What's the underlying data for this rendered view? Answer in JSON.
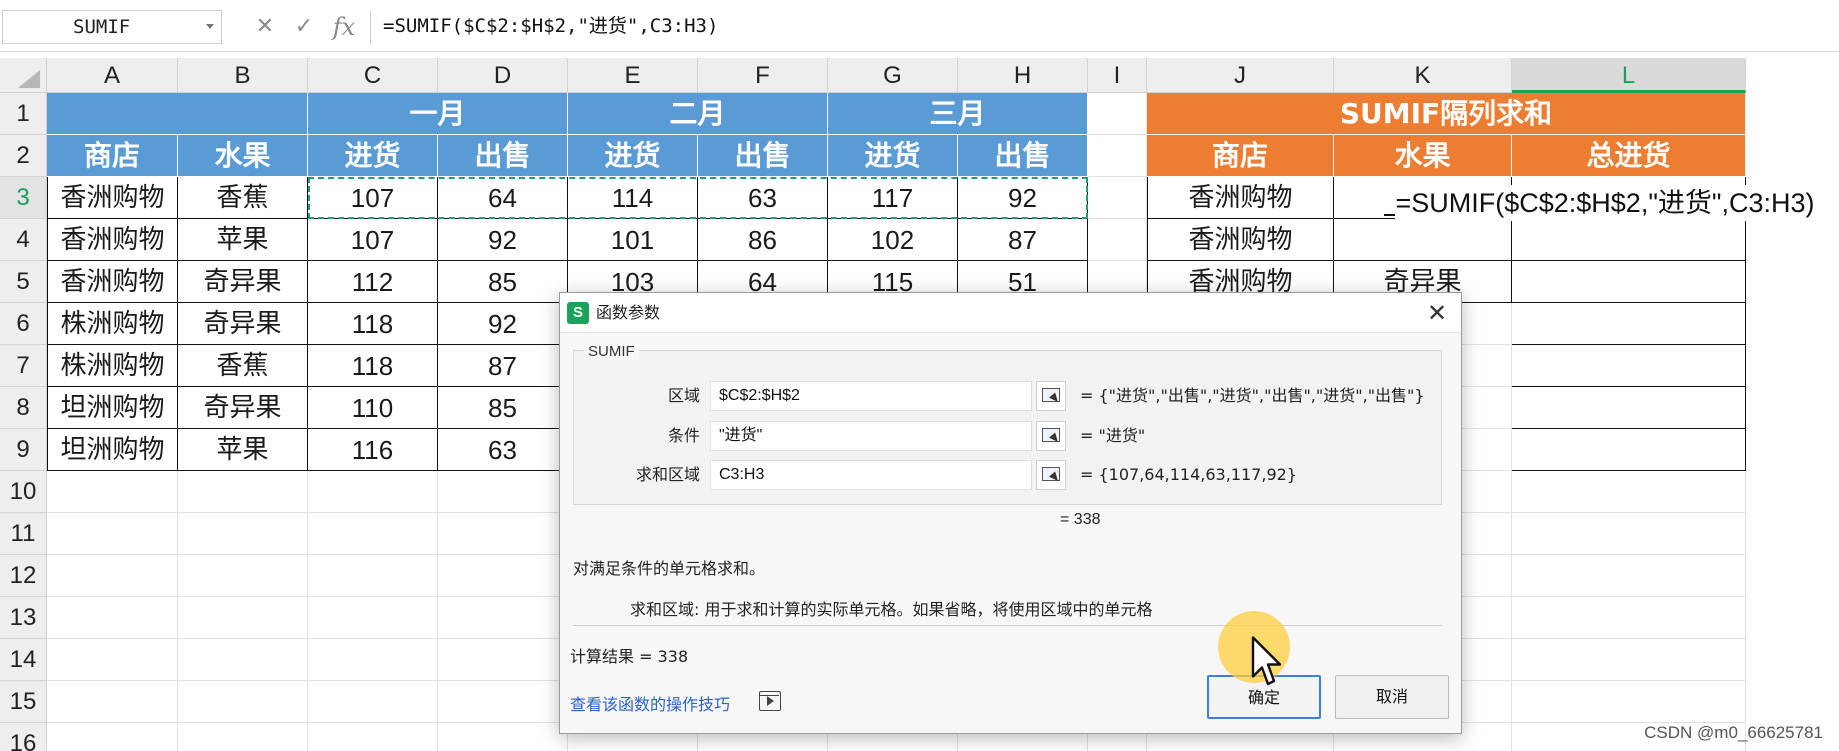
{
  "formula_bar": {
    "name_box": "SUMIF",
    "cancel_icon": "close-icon",
    "confirm_icon": "check-icon",
    "fx_label": "fx",
    "formula": "=SUMIF($C$2:$H$2,\"进货\",C3:H3)"
  },
  "sheet": {
    "columns": [
      "A",
      "B",
      "C",
      "D",
      "E",
      "F",
      "G",
      "H",
      "I",
      "J",
      "K",
      "L"
    ],
    "selected_column": "L",
    "rows": [
      "1",
      "2",
      "3",
      "4",
      "5",
      "6",
      "7",
      "8",
      "9",
      "10",
      "11",
      "12",
      "13",
      "14",
      "15",
      "16"
    ],
    "active_row": "3",
    "table": {
      "month1": "一月",
      "month2": "二月",
      "month3": "三月",
      "h_store": "商店",
      "h_fruit": "水果",
      "h_in": "进货",
      "h_out": "出售",
      "rows": [
        [
          "香洲购物",
          "香蕉",
          "107",
          "64",
          "114",
          "63",
          "117",
          "92"
        ],
        [
          "香洲购物",
          "苹果",
          "107",
          "92",
          "101",
          "86",
          "102",
          "87"
        ],
        [
          "香洲购物",
          "奇异果",
          "112",
          "85",
          "103",
          "64",
          "115",
          "51"
        ],
        [
          "株洲购物",
          "奇异果",
          "118",
          "92",
          "",
          "",
          "",
          ""
        ],
        [
          "株洲购物",
          "香蕉",
          "118",
          "87",
          "",
          "",
          "",
          ""
        ],
        [
          "坦洲购物",
          "奇异果",
          "110",
          "85",
          "",
          "",
          "",
          ""
        ],
        [
          "坦洲购物",
          "苹果",
          "116",
          "63",
          "",
          "",
          "",
          ""
        ]
      ]
    },
    "summary": {
      "title": "SUMIF隔列求和",
      "h_store": "商店",
      "h_fruit": "水果",
      "h_total": "总进货",
      "rows": [
        [
          "香洲购物",
          "",
          ""
        ],
        [
          "香洲购物",
          "",
          ""
        ],
        [
          "香洲购物",
          "奇异果",
          ""
        ]
      ],
      "editing_formula": "=SUMIF($C$2:$H$2,\"进货\",C3:H3)"
    }
  },
  "dialog": {
    "icon_label": "S",
    "title": "函数参数",
    "function_name": "SUMIF",
    "args": [
      {
        "label": "区域",
        "value": "$C$2:$H$2",
        "result": "= {\"进货\",\"出售\",\"进货\",\"出售\",\"进货\",\"出售\"}"
      },
      {
        "label": "条件",
        "value": "\"进货\"",
        "result": "= \"进货\""
      },
      {
        "label": "求和区域",
        "value": "C3:H3",
        "result": "= {107,64,114,63,117,92}"
      }
    ],
    "total": "= 338",
    "description": "对满足条件的单元格求和。",
    "arg_description": "求和区域:   用于求和计算的实际单元格。如果省略，将使用区域中的单元格",
    "result_text": "计算结果 =  338",
    "help_link": "查看该函数的操作技巧",
    "ok_label": "确定",
    "cancel_label": "取消"
  },
  "watermark": "CSDN @m0_66625781",
  "colors": {
    "header_blue": "#5b9bd5",
    "header_orange": "#ed7d31",
    "selection_green": "#1d9e5a",
    "link_blue": "#2a62c9"
  }
}
